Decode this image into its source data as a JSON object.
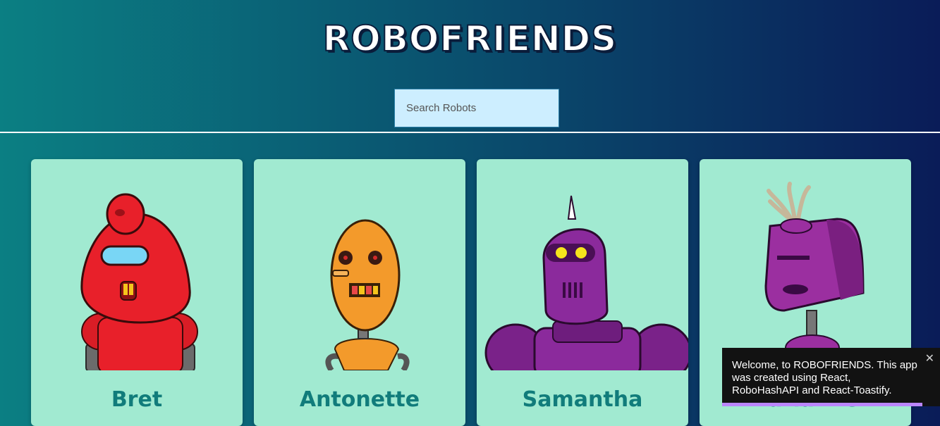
{
  "app": {
    "title": "ROBOFRIENDS"
  },
  "search": {
    "placeholder": "Search Robots",
    "value": ""
  },
  "cards": [
    {
      "name": "Bret",
      "robot_color": "#e8202a"
    },
    {
      "name": "Antonette",
      "robot_color": "#f39a2b"
    },
    {
      "name": "Samantha",
      "robot_color": "#8b2a9c"
    },
    {
      "name": "Karianne",
      "robot_color": "#9b2fa0"
    }
  ],
  "toast": {
    "message": "Welcome, to ROBOFRIENDS. This app was created using React, RoboHashAPI and React-Toastify.",
    "close_label": "✕",
    "progress": 0.92
  },
  "colors": {
    "card_background": "#a1ead1",
    "name_text": "#117c7b",
    "toast_background": "#121212",
    "toast_progress": "#bb86fc",
    "search_background": "#cdeeff"
  }
}
